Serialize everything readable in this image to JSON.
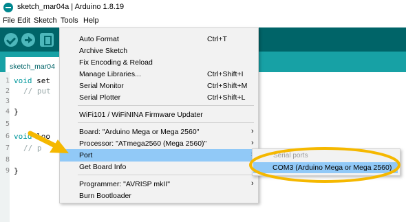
{
  "window": {
    "title": "sketch_mar04a | Arduino 1.8.19"
  },
  "menubar": {
    "items": [
      "File",
      "Edit",
      "Sketch",
      "Tools",
      "Help"
    ]
  },
  "tab": {
    "label": "sketch_mar04"
  },
  "editor": {
    "line_numbers": [
      "1",
      "2",
      "3",
      "4",
      "5",
      "6",
      "7",
      "8",
      "9"
    ],
    "lines": {
      "l1_kw": "void",
      "l1_rest": " set",
      "l2_cmt": "// put",
      "l4": "}",
      "l6_kw": "void",
      "l6_rest": " loo",
      "l7_cmt": "// p",
      "l9": "}"
    }
  },
  "tools_menu": {
    "items": [
      {
        "label": "Auto Format",
        "shortcut": "Ctrl+T"
      },
      {
        "label": "Archive Sketch",
        "shortcut": ""
      },
      {
        "label": "Fix Encoding & Reload",
        "shortcut": ""
      },
      {
        "label": "Manage Libraries...",
        "shortcut": "Ctrl+Shift+I"
      },
      {
        "label": "Serial Monitor",
        "shortcut": "Ctrl+Shift+M"
      },
      {
        "label": "Serial Plotter",
        "shortcut": "Ctrl+Shift+L"
      },
      {
        "label": "WiFi101 / WiFiNINA Firmware Updater",
        "shortcut": ""
      },
      {
        "label": "Board: \"Arduino Mega or Mega 2560\"",
        "shortcut": ""
      },
      {
        "label": "Processor: \"ATmega2560 (Mega 2560)\"",
        "shortcut": ""
      },
      {
        "label": "Port",
        "shortcut": ""
      },
      {
        "label": "Get Board Info",
        "shortcut": ""
      },
      {
        "label": "Programmer: \"AVRISP mkII\"",
        "shortcut": ""
      },
      {
        "label": "Burn Bootloader",
        "shortcut": ""
      }
    ],
    "submenu_arrow": "›"
  },
  "port_submenu": {
    "header": "Serial ports",
    "item": "COM3 (Arduino Mega or Mega 2560)"
  },
  "colors": {
    "toolbar": "#006468",
    "tabstrip": "#17a1a5",
    "highlight": "#91c9f7",
    "annotation": "#f5b800"
  },
  "icons": [
    "arduino-logo-icon",
    "verify-icon",
    "upload-icon",
    "new-sketch-icon",
    "chevron-right-icon",
    "annotation-arrow-icon",
    "annotation-ellipse-icon"
  ]
}
